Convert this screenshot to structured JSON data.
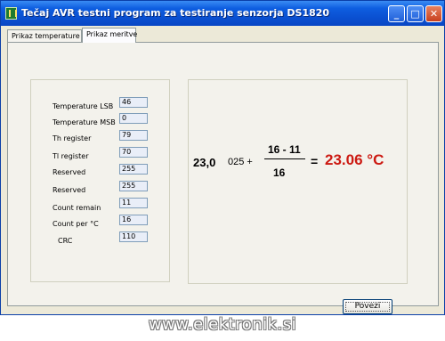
{
  "window": {
    "title": "Tečaj AVR testni program za testiranje senzorja DS1820"
  },
  "titlebar_buttons": {
    "minimize": "_",
    "maximize": "□",
    "close": "✕"
  },
  "tabs": [
    {
      "label": "Prikaz temperature",
      "active": false
    },
    {
      "label": "Prikaz meritve",
      "active": true
    }
  ],
  "registers": [
    {
      "label": "Temperature LSB",
      "value": "46"
    },
    {
      "label": "Temperature MSB",
      "value": "0"
    },
    {
      "label": "Th register",
      "value": "79"
    },
    {
      "label": "Tl register",
      "value": "70"
    },
    {
      "label": "Reserved",
      "value": "255"
    },
    {
      "label": "Reserved",
      "value": "255"
    },
    {
      "label": "Count remain",
      "value": "11"
    },
    {
      "label": "Count per °C",
      "value": "16"
    },
    {
      "label": "CRC",
      "value": "110"
    }
  ],
  "formula": {
    "base": "23,0",
    "minus_quarter": "025 +",
    "numerator": "16 - 11",
    "denominator": "16",
    "equals": "=",
    "result": "23.06 °C"
  },
  "buttons": {
    "refresh": "Povezi"
  },
  "watermark": "www.elektronik.si",
  "colors": {
    "result": "#cc1a12",
    "titlebar": "#0a4fd0"
  }
}
